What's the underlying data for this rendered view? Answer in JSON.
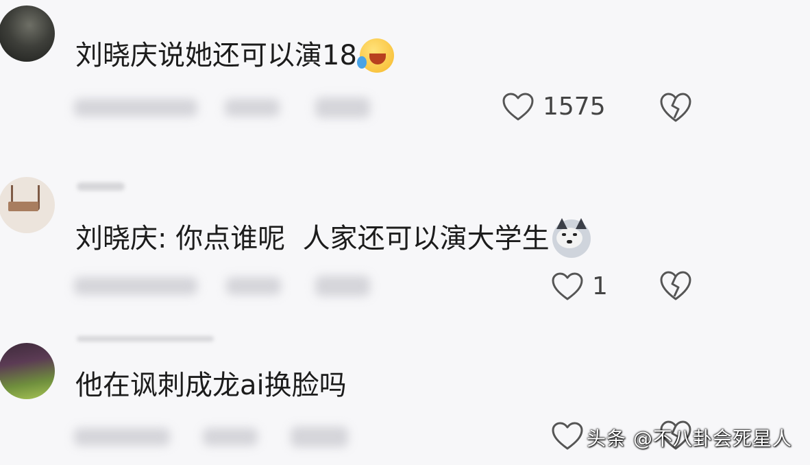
{
  "comments": [
    {
      "text": "刘晓庆说她还可以演18",
      "emoji": "rolling-on-floor-laughing-emoji",
      "like_count": "1575"
    },
    {
      "text": "刘晓庆: 你点谁呢  人家还可以演大学生",
      "emoji": "doge-emoji",
      "like_count": "1"
    },
    {
      "text": "他在讽刺成龙ai换脸吗",
      "emoji": "",
      "like_count": ""
    }
  ],
  "icons": {
    "like": "heart-outline-icon",
    "dislike": "broken-heart-icon"
  },
  "colors": {
    "background": "#f7f7f9",
    "text": "#1c1c1c",
    "icon_stroke": "#555555"
  },
  "watermark": {
    "text": "头条 @不八卦会死星人"
  }
}
